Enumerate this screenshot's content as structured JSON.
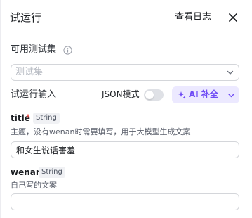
{
  "header": {
    "title": "试运行",
    "view_logs_label": "查看日志"
  },
  "test_set": {
    "label": "可用测试集",
    "placeholder": "测试集"
  },
  "run_input": {
    "label": "试运行输入",
    "json_mode_label": "JSON模式",
    "json_mode_on": false,
    "ai_fill_label": "AI 补全"
  },
  "fields": [
    {
      "name": "title",
      "required": "*",
      "type": "String",
      "description": "主题，没有wenan时需要填写，用于大模型生成文案",
      "value": "和女生说话害羞"
    },
    {
      "name": "wenan",
      "type": "String",
      "description": "自己写的文案",
      "value": ""
    }
  ],
  "colors": {
    "accent": "#6f4cf5",
    "accent_bg": "#ece9ff",
    "required": "#f54a45",
    "border": "#d4d6da"
  },
  "icons": [
    "close-icon",
    "info-icon",
    "chevron-down-icon",
    "sparkle-icon"
  ]
}
